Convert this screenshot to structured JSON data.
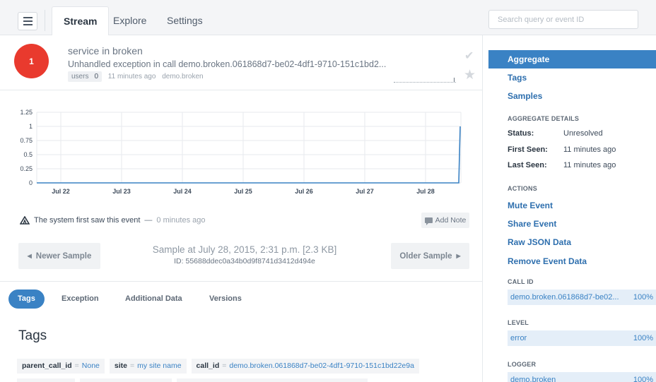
{
  "nav": {
    "tabs": [
      {
        "label": "Stream",
        "active": true
      },
      {
        "label": "Explore",
        "active": false
      },
      {
        "label": "Settings",
        "active": false
      }
    ],
    "search_placeholder": "Search query or event ID"
  },
  "event": {
    "count": "1",
    "title": "service in broken",
    "message": "Unhandled exception in call demo.broken.061868d7-be02-4df1-9710-151c1bd2...",
    "users_label": "users",
    "users_count": "0",
    "time_ago": "11 minutes ago",
    "logger": "demo.broken"
  },
  "chart_data": {
    "type": "line",
    "x": [
      "Jul 22",
      "Jul 23",
      "Jul 24",
      "Jul 25",
      "Jul 26",
      "Jul 27",
      "Jul 28"
    ],
    "y_ticks": [
      "1.25",
      "1",
      "0.75",
      "0.5",
      "0.25",
      "0"
    ],
    "ylim": [
      0,
      1.25
    ],
    "series": [
      {
        "values": [
          0,
          0,
          0,
          0,
          0,
          0,
          0,
          1
        ]
      }
    ],
    "grid": true,
    "color": "#3a82c4"
  },
  "first_seen": {
    "text": "The system first saw this event",
    "dash": "—",
    "time": "0 minutes ago"
  },
  "add_note_label": "Add Note",
  "sample": {
    "newer_label": "Newer Sample",
    "older_label": "Older Sample",
    "title": "Sample at July 28, 2015, 2:31 p.m. [2.3 KB]",
    "id_line": "ID: 55688ddec0a34b0d9f8741d3412d494e"
  },
  "subtabs": [
    {
      "label": "Tags",
      "active": true
    },
    {
      "label": "Exception",
      "active": false
    },
    {
      "label": "Additional Data",
      "active": false
    },
    {
      "label": "Versions",
      "active": false
    }
  ],
  "tags_heading": "Tags",
  "tags": [
    {
      "key": "parent_call_id",
      "value": "None"
    },
    {
      "key": "site",
      "value": "my site name"
    },
    {
      "key": "call_id",
      "value": "demo.broken.061868d7-be02-4df1-9710-151c1bd22e9a"
    }
  ],
  "equals": "=",
  "sidebar": {
    "nav": [
      {
        "label": "Aggregate",
        "active": true
      },
      {
        "label": "Tags",
        "active": false
      },
      {
        "label": "Samples",
        "active": false
      }
    ],
    "details_heading": "AGGREGATE DETAILS",
    "details": [
      {
        "label": "Status:",
        "value": "Unresolved"
      },
      {
        "label": "First Seen:",
        "value": "11 minutes ago"
      },
      {
        "label": "Last Seen:",
        "value": "11 minutes ago"
      }
    ],
    "actions_heading": "ACTIONS",
    "actions": [
      "Mute Event",
      "Share Event",
      "Raw JSON Data",
      "Remove Event Data"
    ],
    "tag_groups": [
      {
        "heading": "CALL ID",
        "value": "demo.broken.061868d7-be02...",
        "pct": "100%"
      },
      {
        "heading": "LEVEL",
        "value": "error",
        "pct": "100%"
      },
      {
        "heading": "LOGGER",
        "value": "demo.broken",
        "pct": "100%"
      }
    ]
  },
  "colors": {
    "accent": "#3a82c4",
    "count_badge": "#e93a2e"
  },
  "icons": {
    "newer": "◀",
    "older": "▶",
    "check": "✔",
    "star": "★"
  }
}
